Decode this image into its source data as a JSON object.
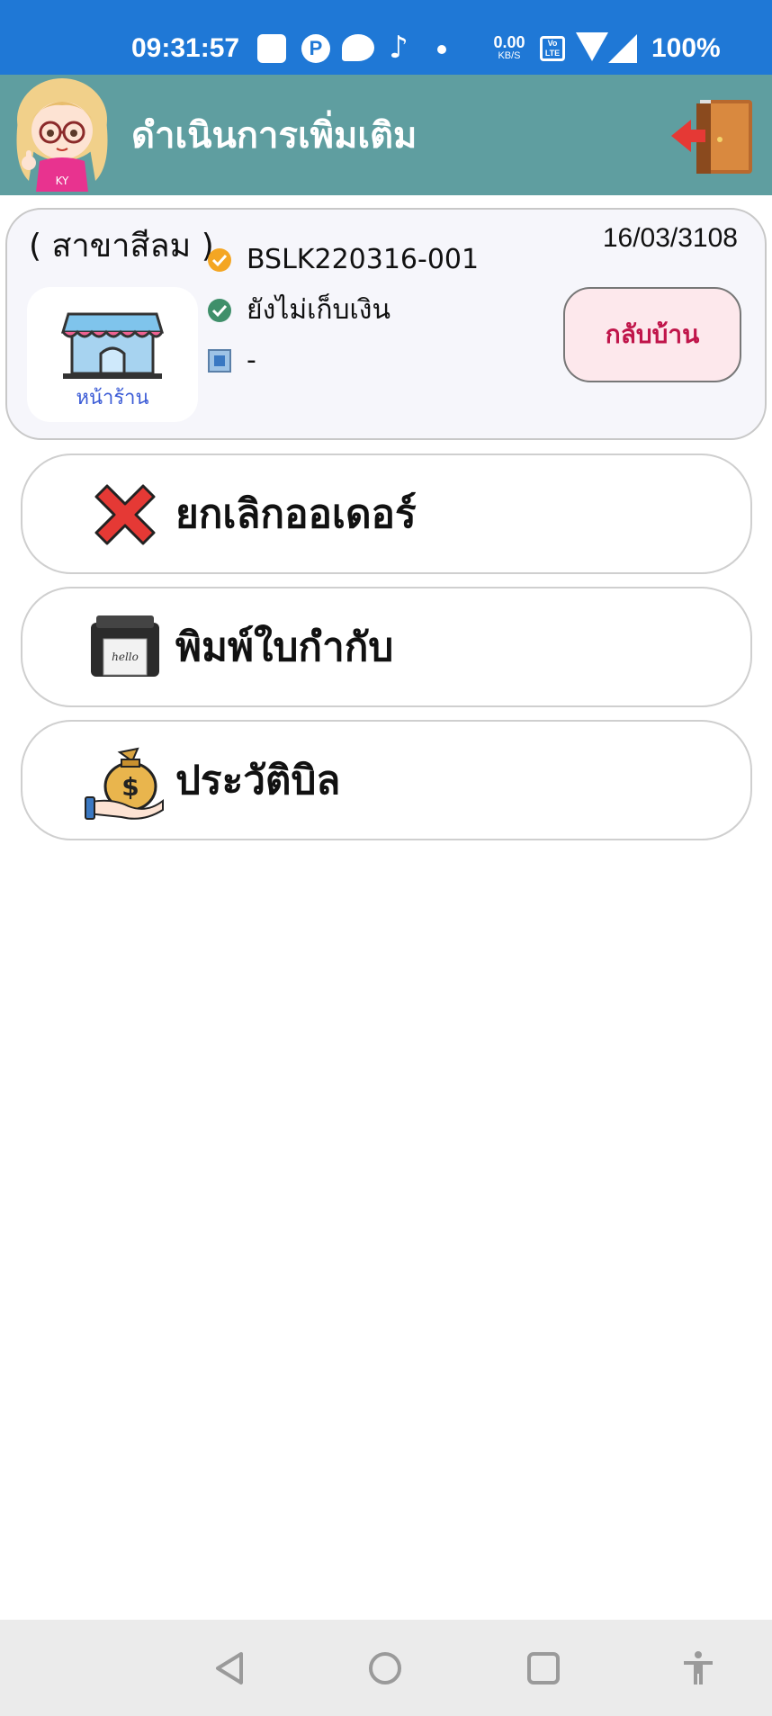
{
  "status_bar": {
    "time": "09:31:57",
    "net_speed_value": "0.00",
    "net_speed_unit": "KB/S",
    "battery": "100%",
    "background_color": "#1f78d6"
  },
  "header": {
    "title": "ดำเนินการเพิ่มเติม",
    "background_color": "#5f9ea0",
    "mascot_badge": "KY"
  },
  "order_card": {
    "branch": "( สาขาสีลม )",
    "date": "16/03/3108",
    "shop_caption": "หน้าร้าน",
    "order_id": "BSLK220316-001",
    "payment_status": "ยังไม่เก็บเงิน",
    "table": "-",
    "go_home_label": "กลับบ้าน"
  },
  "menu": {
    "items": [
      {
        "label": "ยกเลิกออเดอร์",
        "icon": "cancel-x-icon"
      },
      {
        "label": "พิมพ์ใบกำกับ",
        "icon": "printer-icon"
      },
      {
        "label": "ประวัติบิล",
        "icon": "money-bag-icon"
      }
    ]
  },
  "nav_bar": {
    "buttons": [
      "back-triangle-icon",
      "home-circle-icon",
      "recents-square-icon",
      "accessibility-icon"
    ]
  },
  "colors": {
    "accent_red": "#c0154a",
    "card_bg": "#f6f6fb"
  }
}
